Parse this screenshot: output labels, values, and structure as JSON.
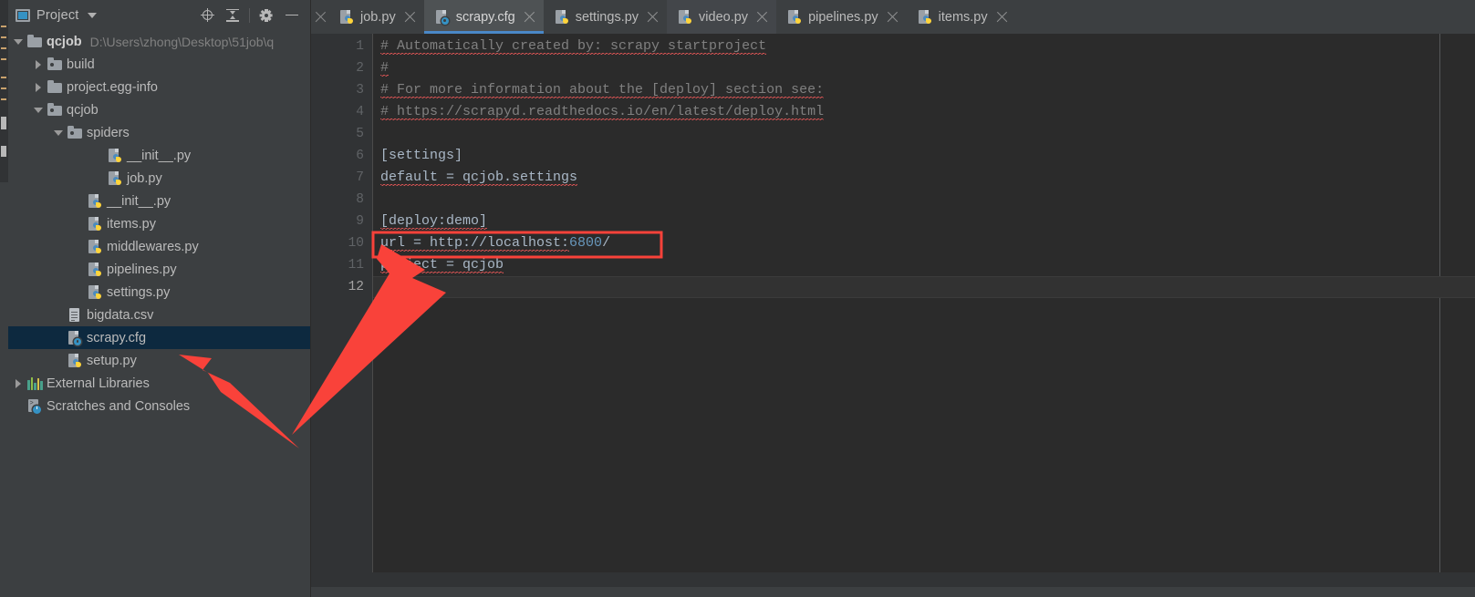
{
  "window": {
    "theme_bg": "#3c3f41",
    "editor_bg": "#2b2b2b",
    "accent": "#4a88c7",
    "selection_bg": "#0d293f",
    "annotation_color": "#f9423a"
  },
  "project_panel": {
    "title": "Project",
    "window_icon": "project-window-icon",
    "caret": "chevron-down-icon",
    "toolbar": [
      {
        "name": "locate-in-tree-icon",
        "label": "Select Opened File"
      },
      {
        "name": "collapse-all-icon",
        "label": "Collapse All"
      },
      {
        "name": "gear-icon",
        "label": "Settings"
      },
      {
        "name": "minimize-icon",
        "label": "Hide"
      }
    ],
    "tree": [
      {
        "id": "qcjob-root",
        "depth": 0,
        "arrow": "down",
        "icon": "folder-icon",
        "label": "qcjob",
        "bold": true,
        "sub": "D:\\Users\\zhong\\Desktop\\51job\\q",
        "selected": false
      },
      {
        "id": "build",
        "depth": 1,
        "arrow": "right",
        "icon": "folder-source-icon",
        "label": "build",
        "bold": false,
        "sub": "",
        "selected": false
      },
      {
        "id": "project-egg-info",
        "depth": 1,
        "arrow": "right",
        "icon": "folder-icon",
        "label": "project.egg-info",
        "bold": false,
        "sub": "",
        "selected": false
      },
      {
        "id": "qcjob-pkg",
        "depth": 1,
        "arrow": "down",
        "icon": "folder-source-icon",
        "label": "qcjob",
        "bold": false,
        "sub": "",
        "selected": false
      },
      {
        "id": "spiders",
        "depth": 2,
        "arrow": "down",
        "icon": "folder-source-icon",
        "label": "spiders",
        "bold": false,
        "sub": "",
        "selected": false
      },
      {
        "id": "spiders-init",
        "depth": 4,
        "arrow": "none",
        "icon": "python-file-icon",
        "label": "__init__.py",
        "bold": false,
        "sub": "",
        "selected": false
      },
      {
        "id": "job-py",
        "depth": 4,
        "arrow": "none",
        "icon": "python-file-icon",
        "label": "job.py",
        "bold": false,
        "sub": "",
        "selected": false
      },
      {
        "id": "pkg-init",
        "depth": 3,
        "arrow": "none",
        "icon": "python-file-icon",
        "label": "__init__.py",
        "bold": false,
        "sub": "",
        "selected": false
      },
      {
        "id": "items-py",
        "depth": 3,
        "arrow": "none",
        "icon": "python-file-icon",
        "label": "items.py",
        "bold": false,
        "sub": "",
        "selected": false
      },
      {
        "id": "middlewares-py",
        "depth": 3,
        "arrow": "none",
        "icon": "python-file-icon",
        "label": "middlewares.py",
        "bold": false,
        "sub": "",
        "selected": false
      },
      {
        "id": "pipelines-py",
        "depth": 3,
        "arrow": "none",
        "icon": "python-file-icon",
        "label": "pipelines.py",
        "bold": false,
        "sub": "",
        "selected": false
      },
      {
        "id": "settings-py",
        "depth": 3,
        "arrow": "none",
        "icon": "python-file-icon",
        "label": "settings.py",
        "bold": false,
        "sub": "",
        "selected": false
      },
      {
        "id": "bigdata-csv",
        "depth": 2,
        "arrow": "none",
        "icon": "csv-file-icon",
        "label": "bigdata.csv",
        "bold": false,
        "sub": "",
        "selected": false
      },
      {
        "id": "scrapy-cfg",
        "depth": 2,
        "arrow": "none",
        "icon": "cfg-file-icon",
        "label": "scrapy.cfg",
        "bold": false,
        "sub": "",
        "selected": true
      },
      {
        "id": "setup-py",
        "depth": 2,
        "arrow": "none",
        "icon": "python-file-icon",
        "label": "setup.py",
        "bold": false,
        "sub": "",
        "selected": false
      },
      {
        "id": "external-libraries",
        "depth": 0,
        "arrow": "right",
        "icon": "libraries-icon",
        "label": "External Libraries",
        "bold": false,
        "sub": "",
        "selected": false
      },
      {
        "id": "scratches",
        "depth": 0,
        "arrow": "none",
        "icon": "scratches-icon",
        "label": "Scratches and Consoles",
        "bold": false,
        "sub": "",
        "selected": false
      }
    ]
  },
  "editor": {
    "tabs": [
      {
        "id": "tab-job-py",
        "label": "job.py",
        "icon": "python-file-icon",
        "active": false,
        "hover": false
      },
      {
        "id": "tab-scrapy-cfg",
        "label": "scrapy.cfg",
        "icon": "cfg-file-icon",
        "active": true,
        "hover": false
      },
      {
        "id": "tab-settings-py",
        "label": "settings.py",
        "icon": "python-file-icon",
        "active": false,
        "hover": false
      },
      {
        "id": "tab-video-py",
        "label": "video.py",
        "icon": "python-file-icon",
        "active": false,
        "hover": true
      },
      {
        "id": "tab-pipelines-py",
        "label": "pipelines.py",
        "icon": "python-file-icon",
        "active": false,
        "hover": false
      },
      {
        "id": "tab-items-py",
        "label": "items.py",
        "icon": "python-file-icon",
        "active": false,
        "hover": false
      }
    ],
    "current_line": 12,
    "line_numbers": [
      "1",
      "2",
      "3",
      "4",
      "5",
      "6",
      "7",
      "8",
      "9",
      "10",
      "11",
      "12"
    ],
    "lines": [
      {
        "n": 1,
        "segments": [
          {
            "t": "# Automatically created by: scrapy startproject",
            "c": "cmt",
            "spell": true
          }
        ]
      },
      {
        "n": 2,
        "segments": [
          {
            "t": "#",
            "c": "cmt",
            "spell": true
          }
        ]
      },
      {
        "n": 3,
        "segments": [
          {
            "t": "# For more information about the [deploy] section see:",
            "c": "cmt",
            "spell": true
          }
        ]
      },
      {
        "n": 4,
        "segments": [
          {
            "t": "# https://scrapyd.readthedocs.io/en/latest/deploy.html",
            "c": "cmt",
            "spell": true
          }
        ]
      },
      {
        "n": 5,
        "segments": []
      },
      {
        "n": 6,
        "segments": [
          {
            "t": "[settings]",
            "c": "",
            "spell": false
          }
        ]
      },
      {
        "n": 7,
        "segments": [
          {
            "t": "default = qcjob.settings",
            "c": "",
            "spell": true
          }
        ]
      },
      {
        "n": 8,
        "segments": []
      },
      {
        "n": 9,
        "segments": [
          {
            "t": "[deploy:demo]",
            "c": "",
            "spell": true
          }
        ]
      },
      {
        "n": 10,
        "segments": [
          {
            "t": "url = http://localhost:",
            "c": "",
            "spell": true
          },
          {
            "t": "6800",
            "c": "num",
            "spell": false
          },
          {
            "t": "/",
            "c": "",
            "spell": false
          }
        ]
      },
      {
        "n": 11,
        "segments": [
          {
            "t": "project = qcjob",
            "c": "",
            "spell": true
          }
        ]
      },
      {
        "n": 12,
        "segments": []
      }
    ]
  },
  "annotations": {
    "highlight_box": {
      "label": "url-line-highlight-box",
      "target_line": 10
    },
    "arrows": [
      {
        "name": "arrow-to-url-line",
        "points_at": "url = http://localhost:6800/"
      },
      {
        "name": "arrow-to-scrapy-cfg",
        "points_at": "scrapy.cfg"
      }
    ]
  }
}
